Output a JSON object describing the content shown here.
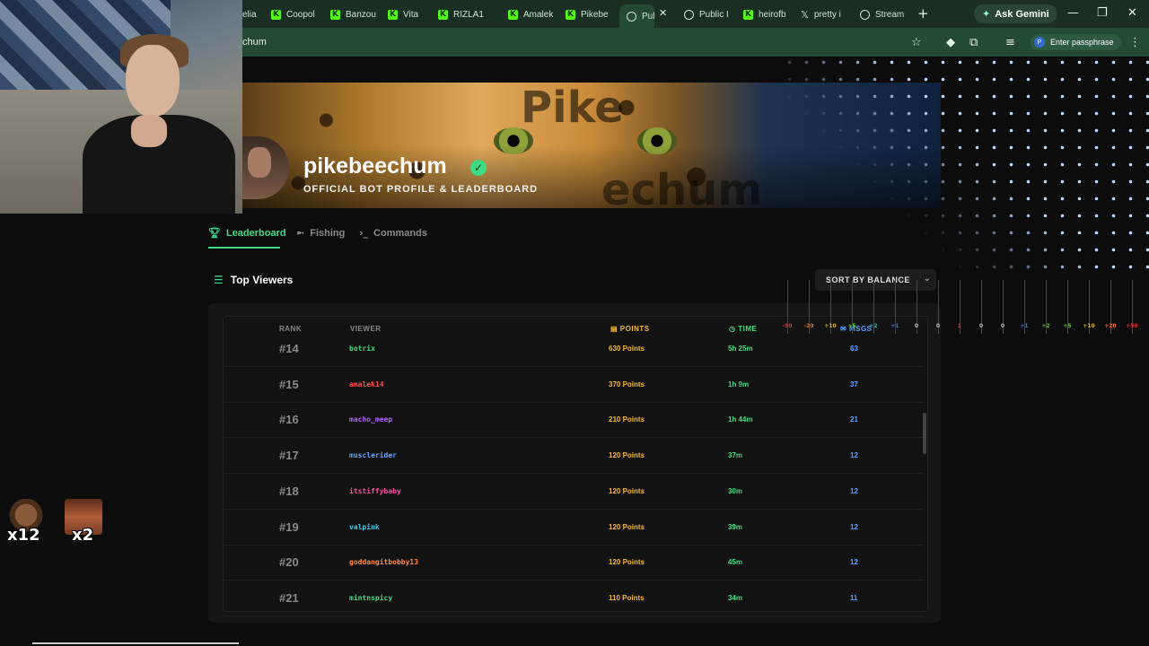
{
  "browser": {
    "tabs": [
      {
        "label": "elia",
        "icon": "none"
      },
      {
        "label": "Coopol",
        "icon": "kick"
      },
      {
        "label": "Banzou",
        "icon": "kick"
      },
      {
        "label": "Vita",
        "icon": "kick"
      },
      {
        "label": "RIZLA1",
        "icon": "kick"
      },
      {
        "label": "Amalek",
        "icon": "kick"
      },
      {
        "label": "Pikebe",
        "icon": "kick"
      },
      {
        "label": "Pul",
        "icon": "globe",
        "active": true
      },
      {
        "label": "Public I",
        "icon": "globe"
      },
      {
        "label": "heirofb",
        "icon": "kick"
      },
      {
        "label": "pretty i",
        "icon": "x"
      },
      {
        "label": "Stream",
        "icon": "globe"
      }
    ],
    "ask_gemini": "Ask Gemini",
    "url_fragment": "chum",
    "passphrase": "Enter passphrase",
    "passphrase_icon": "P"
  },
  "profile": {
    "name": "pikebeechum",
    "subtitle": "OFFICIAL BOT PROFILE & LEADERBOARD",
    "banner_watermark_top": "Pike",
    "banner_watermark_bottom": "echum"
  },
  "nav": {
    "tabs": [
      {
        "label": "Leaderboard",
        "icon": "trophy-icon",
        "active": true
      },
      {
        "label": "Fishing",
        "icon": "fish-icon"
      },
      {
        "label": "Commands",
        "icon": "terminal-icon"
      }
    ]
  },
  "section": {
    "title": "Top Viewers",
    "sort_label": "SORT BY BALANCE"
  },
  "table": {
    "headers": {
      "rank": "RANK",
      "viewer": "VIEWER",
      "points": "POINTS",
      "time": "TIME",
      "msgs": "MSGS"
    },
    "rows": [
      {
        "rank": "#14",
        "viewer": "botrix",
        "points": "630 Points",
        "time": "5h 25m",
        "msgs": "63",
        "color": "#3ddc84"
      },
      {
        "rank": "#15",
        "viewer": "amalek14",
        "points": "370 Points",
        "time": "1h 9m",
        "msgs": "37",
        "color": "#ff4d4d"
      },
      {
        "rank": "#16",
        "viewer": "macho_meep",
        "points": "210 Points",
        "time": "1h 44m",
        "msgs": "21",
        "color": "#b260ff"
      },
      {
        "rank": "#17",
        "viewer": "musclerider",
        "points": "120 Points",
        "time": "37m",
        "msgs": "12",
        "color": "#5aa0ff"
      },
      {
        "rank": "#18",
        "viewer": "itstiffybaby",
        "points": "120 Points",
        "time": "30m",
        "msgs": "12",
        "color": "#ff4fa3"
      },
      {
        "rank": "#19",
        "viewer": "valpink",
        "points": "120 Points",
        "time": "39m",
        "msgs": "12",
        "color": "#3ec8e0"
      },
      {
        "rank": "#20",
        "viewer": "goddangitbobby13",
        "points": "120 Points",
        "time": "45m",
        "msgs": "12",
        "color": "#ff8a3d"
      },
      {
        "rank": "#21",
        "viewer": "mintnspicy",
        "points": "110 Points",
        "time": "34m",
        "msgs": "11",
        "color": "#3ddc84"
      }
    ]
  },
  "audio_meter": {
    "labels": [
      "-50",
      "-20",
      "+10",
      "+5",
      "+2",
      "+1",
      "0",
      "0",
      "1",
      "0",
      "0",
      "+1",
      "+2",
      "+5",
      "+10",
      "+20",
      "+50"
    ],
    "colors": [
      "#d33",
      "#e66a1a",
      "#d9b21a",
      "#5bc236",
      "#2fb5a8",
      "#2f7fd6",
      "#bbb",
      "#bbb",
      "#d33",
      "#bbb",
      "#bbb",
      "#2f7fd6",
      "#5bc236",
      "#5bc236",
      "#d9b21a",
      "#e66a1a",
      "#d33"
    ]
  },
  "emotes": [
    {
      "count": "x12",
      "name": "monkey-emote"
    },
    {
      "count": "x2",
      "name": "laughing-face-emote"
    }
  ],
  "colors": {
    "accent_green": "#3ddc84",
    "points_gold": "#f5b82e",
    "msgs_blue": "#5aa0ff",
    "browser_bg": "#244a33"
  }
}
